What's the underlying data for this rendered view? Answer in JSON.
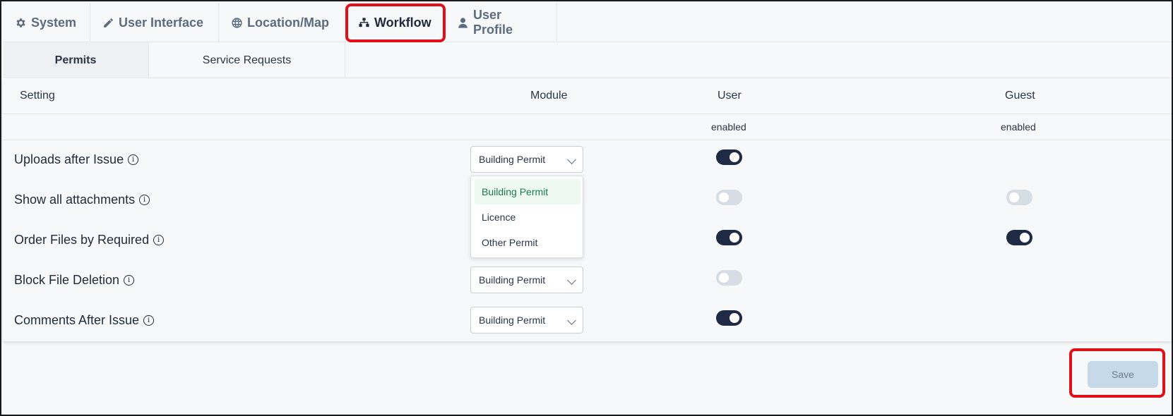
{
  "top_tabs": [
    {
      "label": "System",
      "icon": "gear-icon"
    },
    {
      "label": "User Interface",
      "icon": "pencil-icon"
    },
    {
      "label": "Location/Map",
      "icon": "globe-icon"
    },
    {
      "label": "Workflow",
      "icon": "sitemap-icon",
      "active": true
    },
    {
      "label": "User Profile",
      "icon": "user-icon"
    }
  ],
  "sub_tabs": [
    {
      "label": "Permits",
      "active": true
    },
    {
      "label": "Service Requests"
    }
  ],
  "table": {
    "headers": {
      "setting": "Setting",
      "module": "Module",
      "user": "User",
      "guest": "Guest"
    },
    "sub_headers": {
      "user": "enabled",
      "guest": "enabled"
    },
    "rows": [
      {
        "label": "Uploads after Issue",
        "module": "Building Permit",
        "user": true,
        "guest": null
      },
      {
        "label": "Show all attachments",
        "module": "",
        "user": false,
        "guest": false
      },
      {
        "label": "Order Files by Required",
        "module": "",
        "user": true,
        "guest": true
      },
      {
        "label": "Block File Deletion",
        "module": "Building Permit",
        "user": false,
        "guest": null
      },
      {
        "label": "Comments After Issue",
        "module": "Building Permit",
        "user": true,
        "guest": null
      }
    ]
  },
  "module_dropdown": {
    "options": [
      "Building Permit",
      "Licence",
      "Other Permit"
    ],
    "selected": "Building Permit"
  },
  "save_label": "Save",
  "colors": {
    "highlight": "#e0101a",
    "toggle_on": "#1f2a44",
    "toggle_off": "#d7dde5",
    "selected_option": "#1b7a4a"
  }
}
